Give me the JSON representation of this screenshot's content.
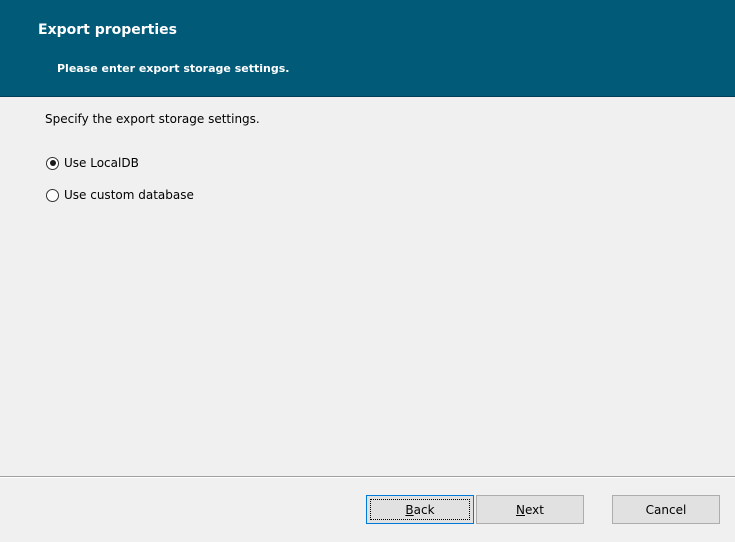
{
  "header": {
    "title": "Export properties",
    "subtitle": "Please enter export storage settings."
  },
  "content": {
    "instruction": "Specify the export storage settings.",
    "options": [
      {
        "label": "Use LocalDB",
        "checked": true
      },
      {
        "label": "Use custom database",
        "checked": false
      }
    ]
  },
  "footer": {
    "back": {
      "accel": "B",
      "rest": "ack"
    },
    "next": {
      "accel": "N",
      "rest": "ext"
    },
    "cancel": "Cancel"
  },
  "colors": {
    "header_bg": "#005a78",
    "dialog_bg": "#f0f0f0",
    "button_bg": "#e1e1e1"
  }
}
